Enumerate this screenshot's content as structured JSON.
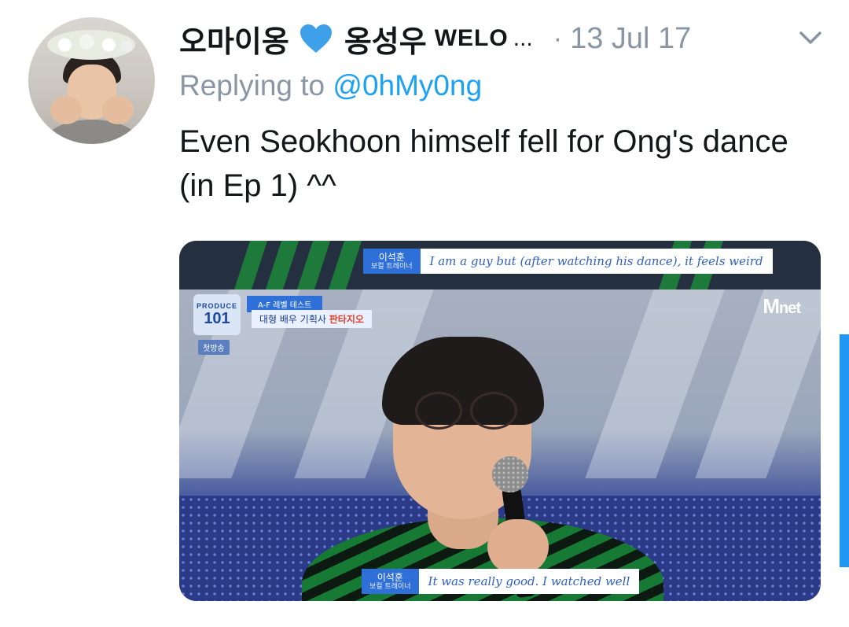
{
  "tweet": {
    "display_name": "오마이옹",
    "name_suffix": "옹성우",
    "handle_fragment": "WELO",
    "ellipsis": "...",
    "separator": "·",
    "date": "13 Jul 17",
    "replying_prefix": "Replying to",
    "reply_to": "@0hMy0ng",
    "text": "Even Seokhoon himself fell for Ong's dance (in Ep 1) ^^"
  },
  "media": {
    "top_caption": {
      "speaker": "이석훈",
      "role": "보컬 트레이너",
      "text": "I am a guy but (after watching his dance), it feels weird"
    },
    "bottom_caption": {
      "speaker": "이석훈",
      "role": "보컬 트레이너",
      "text": "It was really good. I watched well"
    },
    "show_logo": {
      "line1": "PRODUCE",
      "line2": "101"
    },
    "episode_tag": "첫방송",
    "round_label": "A-F 레벨 테스트",
    "round_sub_prefix": "대형 배우 기획사",
    "round_sub_highlight": "판타지오",
    "broadcaster": {
      "m": "M",
      "rest": "net"
    }
  },
  "colors": {
    "accent": "#1da1f2",
    "muted": "#8a96a3",
    "heart": "#3ea0e8",
    "scroll": "#2196f3"
  },
  "icons": {
    "heart": "blue-heart-icon",
    "menu": "chevron-down-icon"
  }
}
